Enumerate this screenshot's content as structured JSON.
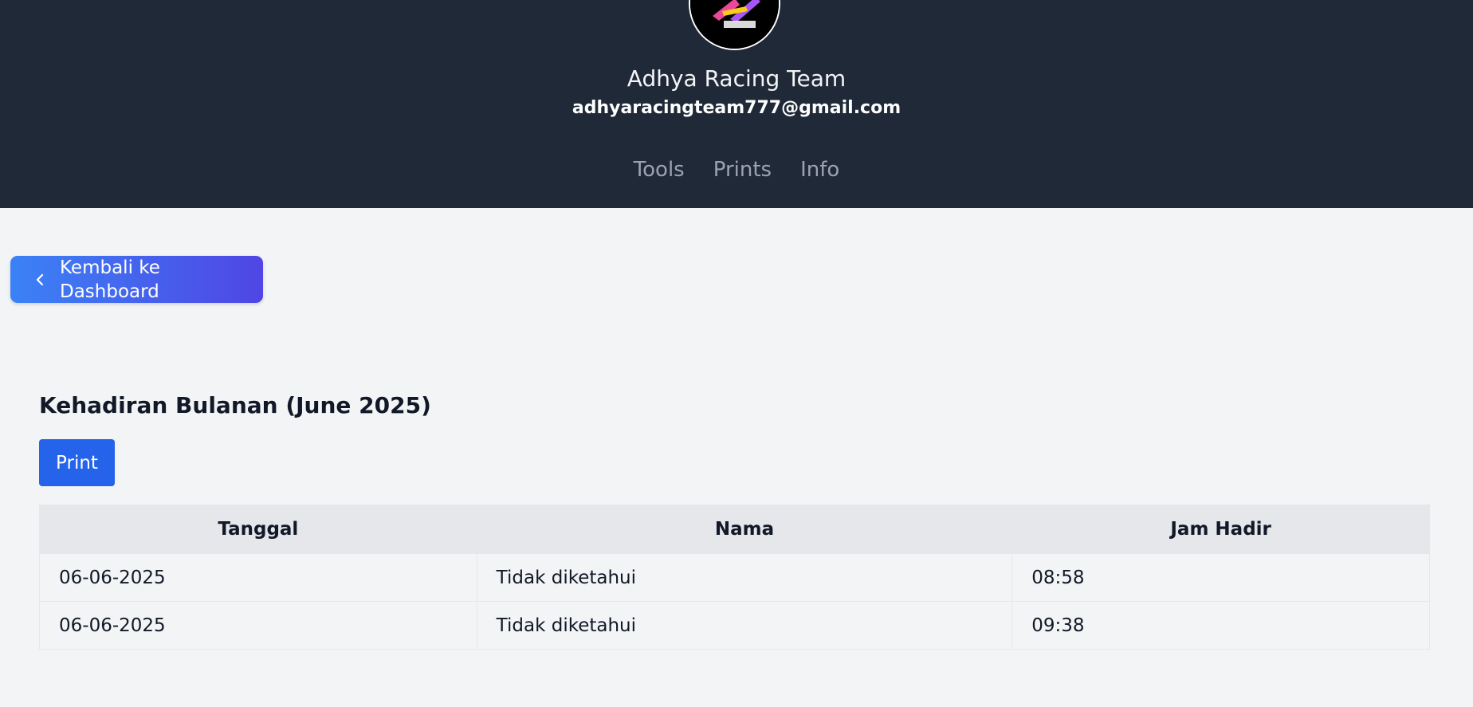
{
  "header": {
    "team_name": "Adhya Racing Team",
    "email": "adhyaracingteam777@gmail.com",
    "logo_icon": "team-logo",
    "nav": [
      {
        "label": "Tools"
      },
      {
        "label": "Prints"
      },
      {
        "label": "Info"
      }
    ]
  },
  "back_button": {
    "label": "Kembali ke Dashboard",
    "icon": "chevron-left-icon"
  },
  "main": {
    "title": "Kehadiran Bulanan (June 2025)",
    "print_label": "Print",
    "table": {
      "columns": [
        "Tanggal",
        "Nama",
        "Jam Hadir"
      ],
      "rows": [
        [
          "06-06-2025",
          "Tidak diketahui",
          "08:58"
        ],
        [
          "06-06-2025",
          "Tidak diketahui",
          "09:38"
        ]
      ]
    }
  },
  "colors": {
    "header_bg": "#1f2937",
    "page_bg": "#f3f4f6",
    "print_button": "#2563eb",
    "back_gradient_start": "#3b82f6",
    "back_gradient_end": "#4f46e5"
  }
}
